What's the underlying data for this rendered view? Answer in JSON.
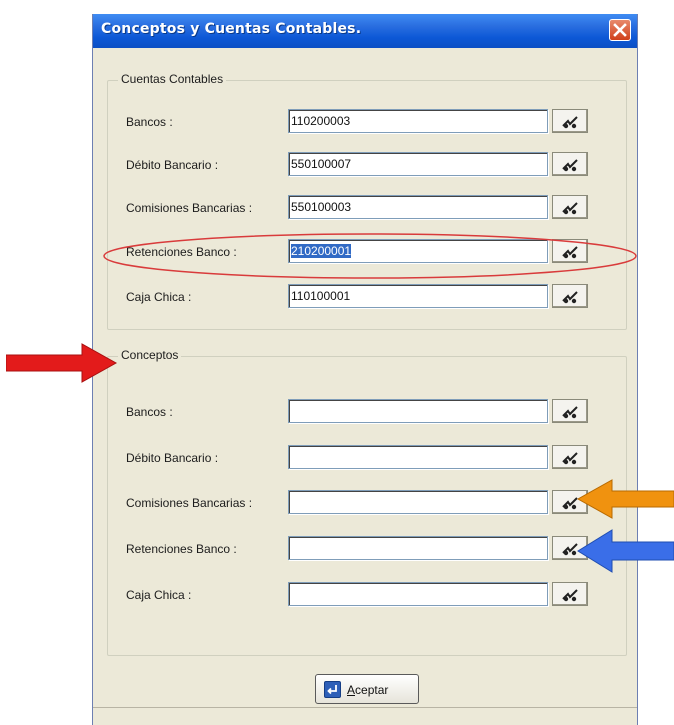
{
  "window": {
    "title": "Conceptos  y Cuentas Contables."
  },
  "cuentas": {
    "legend": "Cuentas Contables",
    "rows": [
      {
        "label": "Bancos :",
        "value": "110200003"
      },
      {
        "label": "Débito Bancario :",
        "value": "550100007"
      },
      {
        "label": "Comisiones Bancarias :",
        "value": "550100003"
      },
      {
        "label": "Retenciones Banco :",
        "value": "210200001"
      },
      {
        "label": "Caja Chica :",
        "value": "110100001"
      }
    ]
  },
  "conceptos": {
    "legend": "Conceptos",
    "rows": [
      {
        "label": "Bancos :",
        "value": ""
      },
      {
        "label": "Débito Bancario :",
        "value": ""
      },
      {
        "label": "Comisiones Bancarias :",
        "value": ""
      },
      {
        "label": "Retenciones Banco :",
        "value": ""
      },
      {
        "label": "Caja Chica :",
        "value": ""
      }
    ]
  },
  "buttons": {
    "accept_prefix": "A",
    "accept_rest": "ceptar"
  },
  "icons": {
    "lookup": "glasses-icon",
    "close": "close-icon",
    "accept": "enter-icon"
  },
  "colors": {
    "title_bar": "#0c58d6",
    "annotation_ellipse": "#d93b3b",
    "arrow_red": "#e31b1b",
    "arrow_orange": "#f0920f",
    "arrow_blue": "#3a6ee8"
  }
}
